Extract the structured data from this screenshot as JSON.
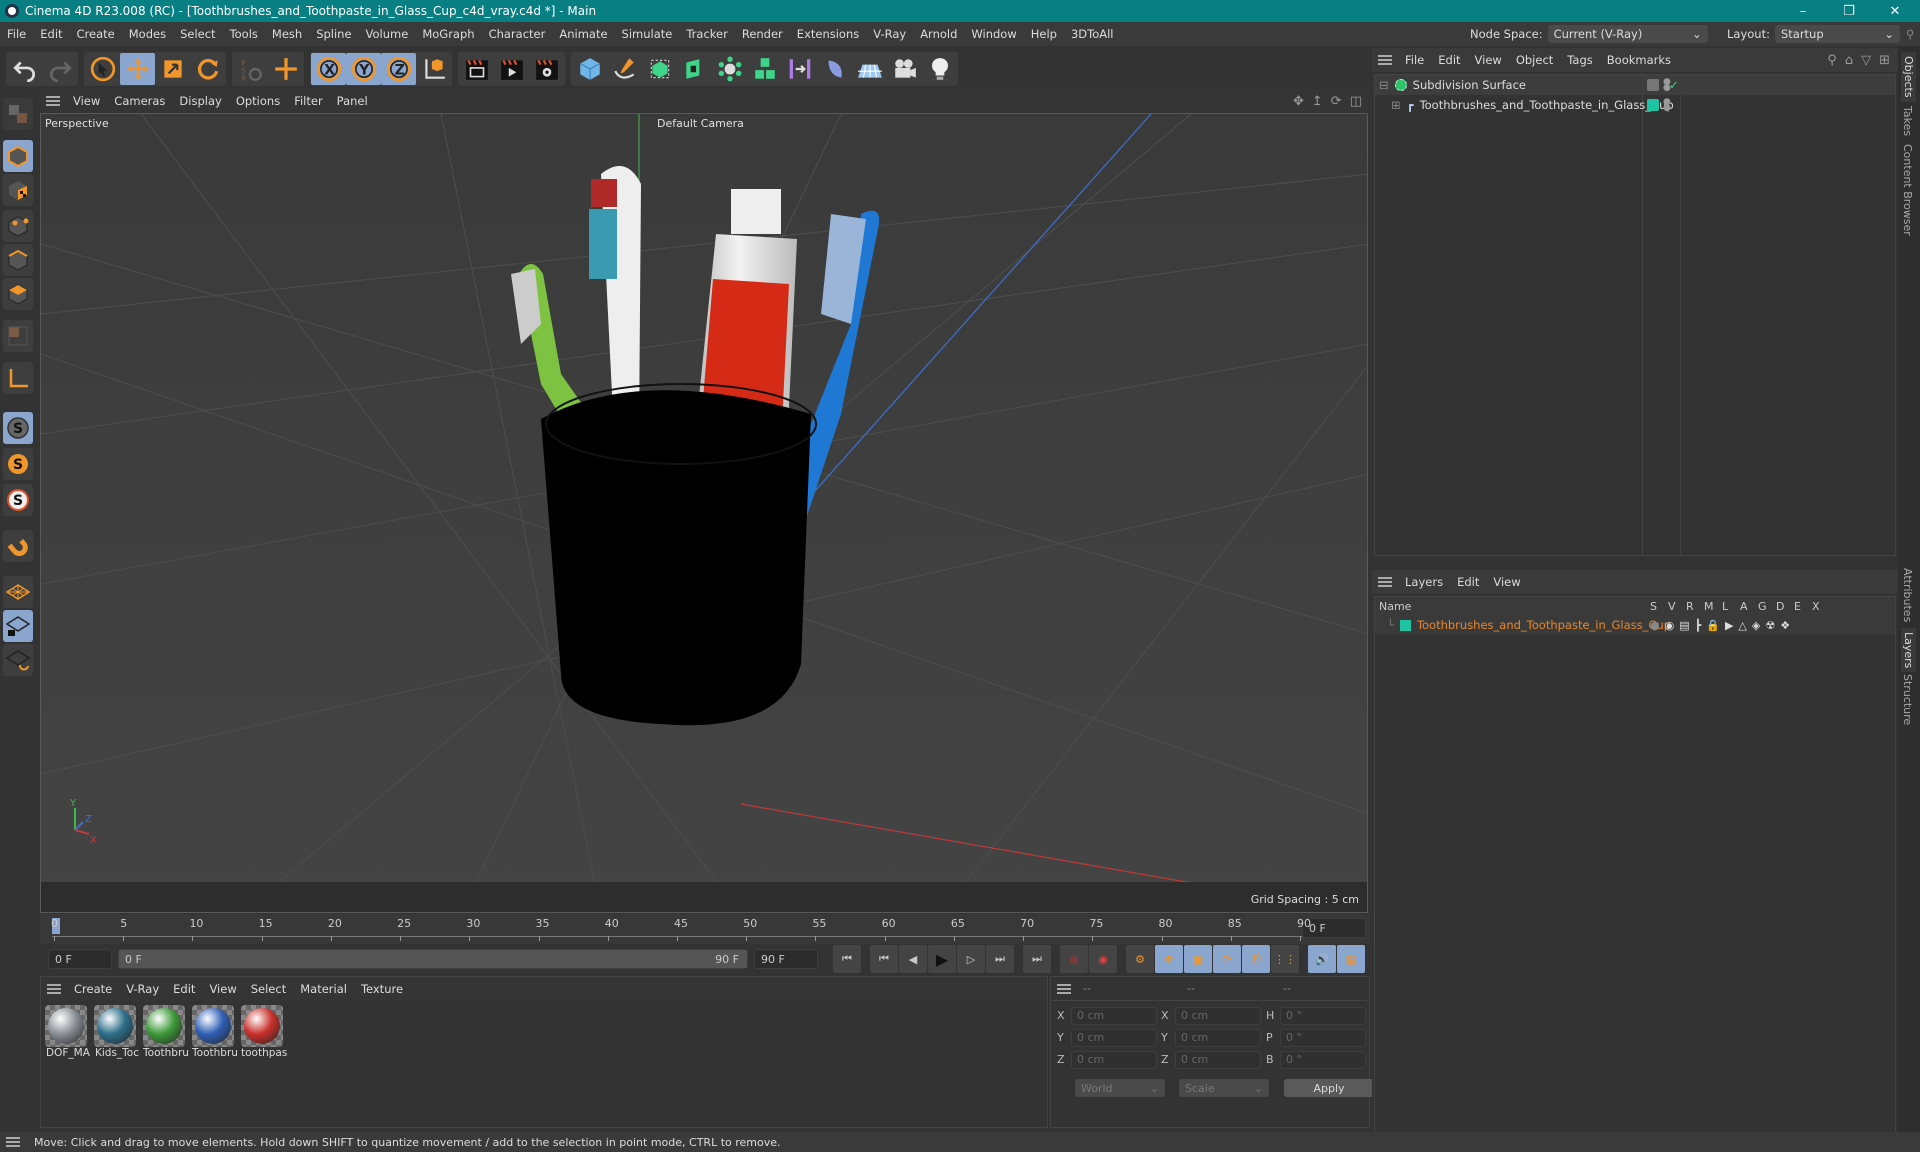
{
  "window": {
    "title": "Cinema 4D R23.008 (RC) - [Toothbrushes_and_Toothpaste_in_Glass_Cup_c4d_vray.c4d *] - Main",
    "controls": [
      "minimize",
      "restore",
      "close"
    ]
  },
  "menubar": {
    "items": [
      "File",
      "Edit",
      "Create",
      "Modes",
      "Select",
      "Tools",
      "Mesh",
      "Spline",
      "Volume",
      "MoGraph",
      "Character",
      "Animate",
      "Simulate",
      "Tracker",
      "Render",
      "Extensions",
      "V-Ray",
      "Arnold",
      "Window",
      "Help",
      "3DToAll"
    ],
    "node_space_label": "Node Space:",
    "node_space_value": "Current (V-Ray)",
    "layout_label": "Layout:",
    "layout_value": "Startup"
  },
  "toolbar": {
    "groups": [
      [
        "undo-icon",
        "redo-icon"
      ],
      [
        "select-arrow-icon",
        "move-icon",
        "scale-icon",
        "rotate-icon"
      ],
      [
        "psr-icon",
        "move-axis-icon"
      ],
      [
        "x-axis-lock-icon",
        "y-axis-lock-icon",
        "z-axis-lock-icon",
        "coordinate-system-icon"
      ],
      [
        "render-view-icon",
        "render-picture-viewer-icon",
        "render-settings-icon"
      ],
      [
        "cube-primitive-icon",
        "pen-spline-icon",
        "subdivision-surface-icon",
        "extrude-icon",
        "array-icon",
        "mograph-cloner-icon",
        "symmetry-icon",
        "deformer-icon",
        "floor-icon",
        "camera-icon",
        "light-icon"
      ]
    ]
  },
  "leftbar": {
    "tools": [
      "make-editable-icon",
      "model-mode-icon",
      "texture-mode-icon",
      "point-mode-icon",
      "edge-mode-icon",
      "polygon-mode-icon",
      "uv-mode-icon",
      "axis-mode-icon",
      "snap-icon",
      "snap-settings-icon",
      "solo-icon",
      "magnet-icon",
      "workplane-icon",
      "locked-workplane-icon",
      "workplane-rotate-icon"
    ]
  },
  "viewport": {
    "menu": [
      "View",
      "Cameras",
      "Display",
      "Options",
      "Filter",
      "Panel"
    ],
    "projection": "Perspective",
    "camera": "Default Camera",
    "grid_spacing": "Grid Spacing : 5 cm",
    "nav_icons": [
      "move-view-icon",
      "zoom-view-icon",
      "rotate-view-icon",
      "toggle-layout-icon"
    ],
    "axis_labels": {
      "x": "X",
      "y": "Y",
      "z": "Z"
    }
  },
  "timeline": {
    "ticks": [
      "0",
      "5",
      "10",
      "15",
      "20",
      "25",
      "30",
      "35",
      "40",
      "45",
      "50",
      "55",
      "60",
      "65",
      "70",
      "75",
      "80",
      "85",
      "90"
    ],
    "current_frame": "0 F",
    "start_field": "0 F",
    "range_start": "0 F",
    "range_end": "90 F",
    "end_field": "90 F",
    "playhead_frame": 0,
    "max_frame": 90
  },
  "materials": {
    "menu": [
      "Create",
      "V-Ray",
      "Edit",
      "View",
      "Select",
      "Material",
      "Texture"
    ],
    "items": [
      {
        "name": "DOF_MA",
        "color": "#8a8f96"
      },
      {
        "name": "Kids_Toc",
        "color": "#2d6f8a"
      },
      {
        "name": "Toothbru",
        "color": "#3e9a3a"
      },
      {
        "name": "Toothbru",
        "color": "#2f5fb5"
      },
      {
        "name": "toothpas",
        "color": "#c9302a"
      }
    ]
  },
  "coordinates": {
    "headers": [
      "--",
      "--",
      "--"
    ],
    "rows": [
      {
        "l1": "X",
        "v1": "0 cm",
        "l2": "X",
        "v2": "0 cm",
        "l3": "H",
        "v3": "0 °"
      },
      {
        "l1": "Y",
        "v1": "0 cm",
        "l2": "Y",
        "v2": "0 cm",
        "l3": "P",
        "v3": "0 °"
      },
      {
        "l1": "Z",
        "v1": "0 cm",
        "l2": "Z",
        "v2": "0 cm",
        "l3": "B",
        "v3": "0 °"
      }
    ],
    "space": "World",
    "mode": "Scale",
    "apply": "Apply"
  },
  "objects": {
    "menu": [
      "File",
      "Edit",
      "View",
      "Object",
      "Tags",
      "Bookmarks"
    ],
    "items": [
      {
        "name": "Subdivision Surface",
        "color": "#2fc46a"
      },
      {
        "name": "Toothbrushes_and_Toothpaste_in_Glass_Cup",
        "color": "#1ec4a4"
      }
    ]
  },
  "layers": {
    "menu": [
      "Layers",
      "Edit",
      "View"
    ],
    "columns": [
      "Name",
      "S",
      "V",
      "R",
      "M",
      "L",
      "A",
      "G",
      "D",
      "E",
      "X"
    ],
    "items": [
      {
        "name": "Toothbrushes_and_Toothpaste_in_Glass_Cup",
        "color": "#1ec4a4",
        "text_color": "#e8872a"
      }
    ]
  },
  "side_tabs": {
    "top": [
      "Objects",
      "Takes",
      "Content Browser"
    ],
    "bottom": [
      "Attributes",
      "Layers",
      "Structure"
    ]
  },
  "status": "Move: Click and drag to move elements. Hold down SHIFT to quantize movement / add to the selection in point mode, CTRL to remove.",
  "colors": {
    "titlebar": "#077f83",
    "accent_orange": "#f0962a",
    "active_blue": "#8aa6cf"
  }
}
